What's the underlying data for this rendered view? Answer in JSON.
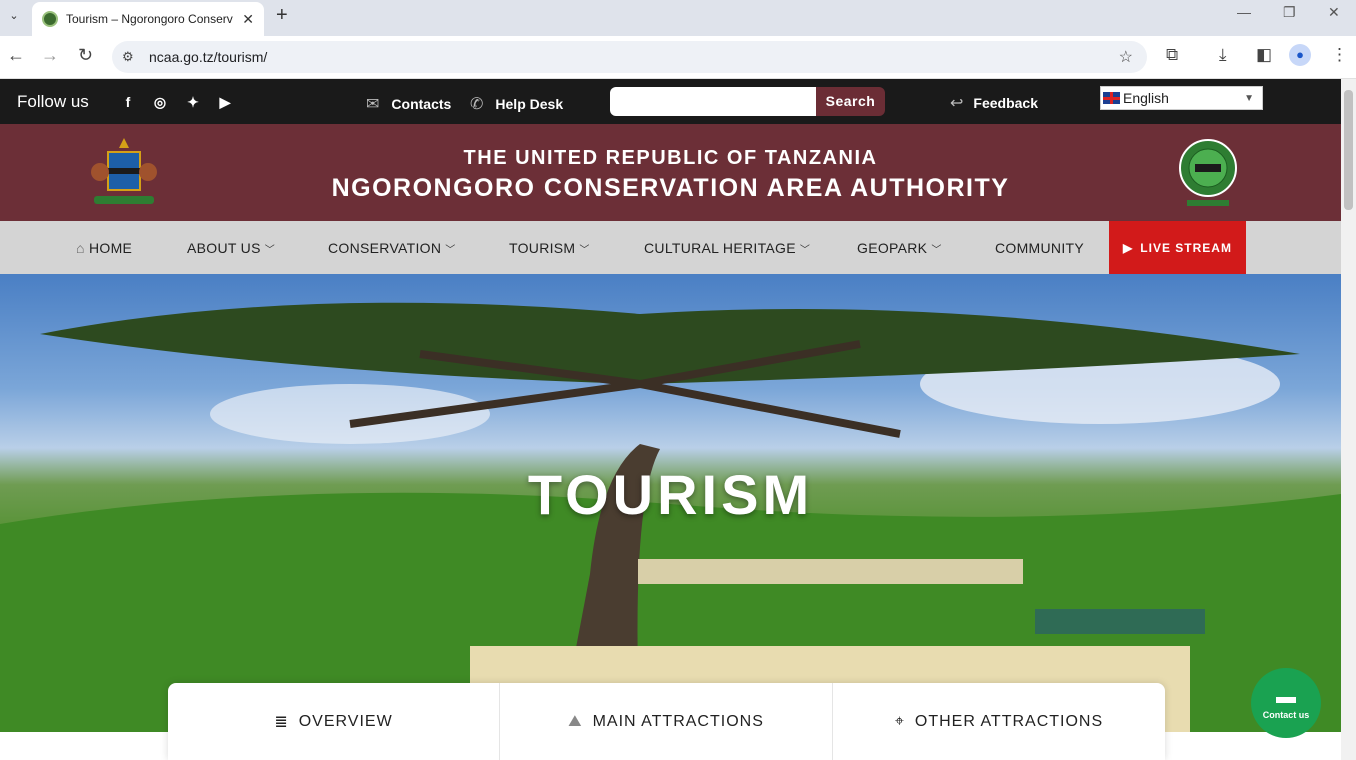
{
  "browser": {
    "tab_title": "Tourism – Ngorongoro Conserv",
    "url": "ncaa.go.tz/tourism/"
  },
  "topbar": {
    "follow_label": "Follow us",
    "contacts_label": "Contacts",
    "helpdesk_label": "Help Desk",
    "search_placeholder": "",
    "search_button": "Search",
    "feedback_label": "Feedback",
    "language_selected": "English"
  },
  "header": {
    "line1": "THE UNITED REPUBLIC OF TANZANIA",
    "line2": "NGORONGORO CONSERVATION AREA AUTHORITY",
    "brand_color": "#6c2f37"
  },
  "nav": {
    "items": [
      {
        "label": "HOME"
      },
      {
        "label": "ABOUT US"
      },
      {
        "label": "CONSERVATION"
      },
      {
        "label": "TOURISM"
      },
      {
        "label": "CULTURAL HERITAGE"
      },
      {
        "label": "GEOPARK"
      },
      {
        "label": "COMMUNITY"
      }
    ],
    "live_label": "LIVE STREAM",
    "live_color": "#d21a1a"
  },
  "hero": {
    "title": "TOURISM"
  },
  "section_tabs": [
    {
      "label": "OVERVIEW"
    },
    {
      "label": "MAIN ATTRACTIONS"
    },
    {
      "label": "OTHER ATTRACTIONS"
    }
  ],
  "floating": {
    "contact_label": "Contact us",
    "color": "#1aa251"
  }
}
